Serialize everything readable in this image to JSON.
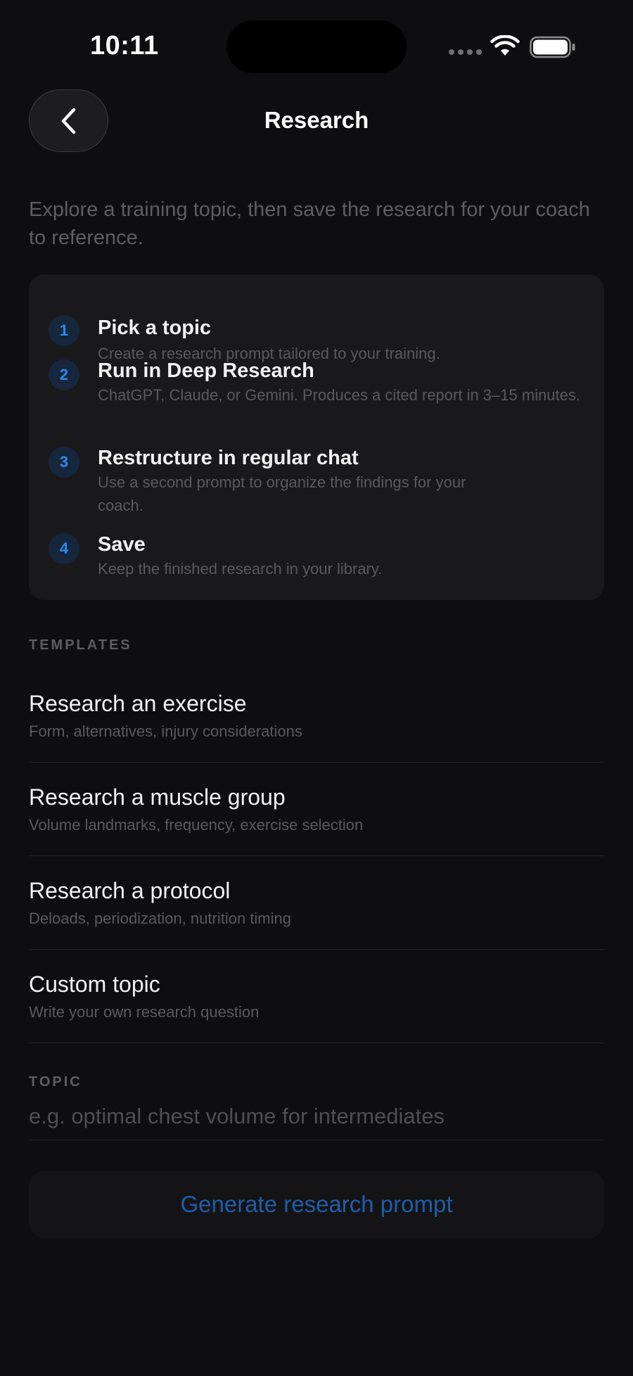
{
  "status_bar": {
    "time": "10:11"
  },
  "header": {
    "title": "Research",
    "back_icon": "chevron-left-icon"
  },
  "intro": "Explore a training topic, then save the research for your coach to reference.",
  "steps": [
    {
      "number": "1",
      "title": "Pick a topic",
      "description": "Create a research prompt tailored to your training."
    },
    {
      "number": "2",
      "title": "Run in Deep Research",
      "description": "ChatGPT, Claude, or Gemini. Produces a cited report in 3–15 minutes."
    },
    {
      "number": "3",
      "title": "Restructure in regular chat",
      "description": "Use a second prompt to organize the findings for your coach."
    },
    {
      "number": "4",
      "title": "Save",
      "description": "Keep the finished research in your library."
    }
  ],
  "templates": {
    "label": "TEMPLATES",
    "items": [
      {
        "title": "Research an exercise",
        "subtitle": "Form, alternatives, injury considerations"
      },
      {
        "title": "Research a muscle group",
        "subtitle": "Volume landmarks, frequency, exercise selection"
      },
      {
        "title": "Research a protocol",
        "subtitle": "Deloads, periodization, nutrition timing"
      },
      {
        "title": "Custom topic",
        "subtitle": "Write your own research question"
      }
    ]
  },
  "topic": {
    "label": "TOPIC",
    "value": "",
    "placeholder": "e.g. optimal chest volume for intermediates"
  },
  "generate_button": {
    "label": "Generate research prompt"
  },
  "colors": {
    "background": "#0e0e10",
    "card": "#19191c",
    "accent": "#2f88f0",
    "button_text": "#1e5da8"
  }
}
